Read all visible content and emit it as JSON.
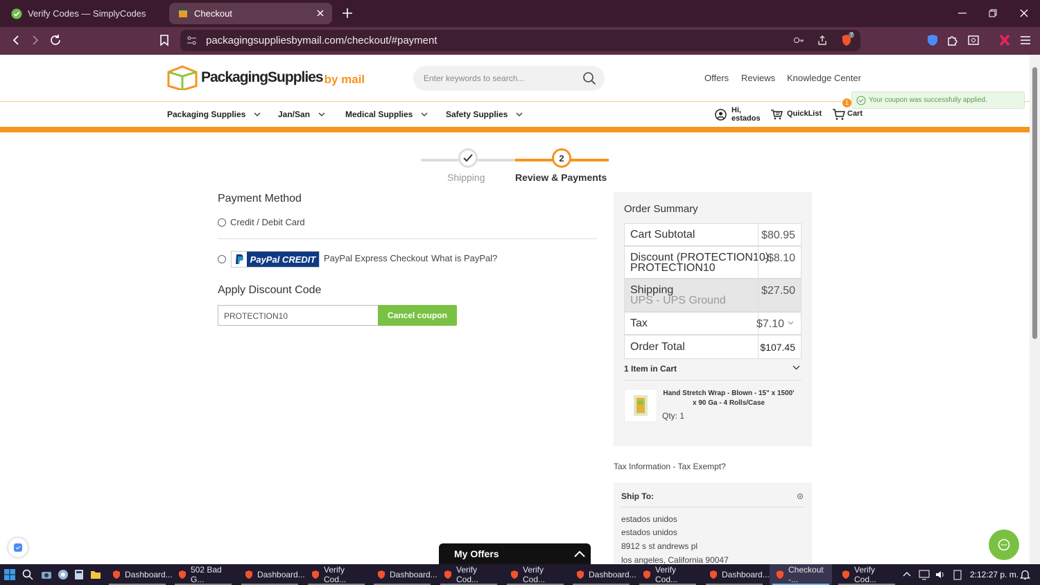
{
  "browser": {
    "tabs": [
      {
        "title": "Verify Codes — SimplyCodes",
        "active": false
      },
      {
        "title": "Checkout",
        "active": true
      }
    ],
    "url": "packagingsuppliesbymail.com/checkout/#payment",
    "extension_badge": "7"
  },
  "header": {
    "logo_main": "PackagingSupplies",
    "logo_sub": "by mail",
    "search_placeholder": "Enter keywords to search...",
    "links": [
      "Offers",
      "Reviews",
      "Knowledge Center"
    ],
    "toast": "Your coupon was successfully applied.",
    "nav": [
      "Packaging Supplies",
      "Jan/San",
      "Medical Supplies",
      "Safety Supplies"
    ],
    "account_hi": "Hi,",
    "account_name": "estados",
    "quicklist": "QuickList",
    "cart": "Cart",
    "cart_count": "1"
  },
  "stepper": {
    "step1_label": "Shipping",
    "step2_label": "Review & Payments",
    "step2_number": "2"
  },
  "payment": {
    "title": "Payment Method",
    "credit_label": "Credit / Debit Card",
    "paypal_button": "PayPal CREDIT",
    "paypal_express": "PayPal Express Checkout",
    "paypal_what": "What is PayPal?",
    "discount_title": "Apply Discount Code",
    "coupon_value": "PROTECTION10",
    "cancel_coupon": "Cancel coupon"
  },
  "summary": {
    "title": "Order Summary",
    "rows": [
      {
        "label": "Cart Subtotal",
        "value": "$80.95"
      },
      {
        "label": "Discount (PROTECTION10)",
        "label2": "PROTECTION10",
        "value": "-$8.10"
      },
      {
        "label": "Shipping",
        "label2": "UPS - UPS Ground",
        "value": "$27.50"
      },
      {
        "label": "Tax",
        "value": "$7.10"
      },
      {
        "label": "Order Total",
        "value": "$107.45"
      }
    ],
    "items_in_cart": "1 Item in Cart",
    "product_name": "Hand Stretch Wrap - Blown - 15\" x 1500' x 90 Ga - 4 Rolls/Case",
    "product_qty": "Qty: 1"
  },
  "tax_info": "Tax Information - Tax Exempt?",
  "ship_to": {
    "title": "Ship To:",
    "lines": [
      "estados unidos",
      "estados unidos",
      "8912 s st andrews pl",
      "los angeles, California 90047"
    ]
  },
  "my_offers": "My Offers",
  "taskbar": {
    "items": [
      "Dashboard...",
      "502 Bad G...",
      "Dashboard...",
      "Verify Cod...",
      "Dashboard...",
      "Verify Cod...",
      "Verify Cod...",
      "Dashboard...",
      "Verify Cod...",
      "Dashboard...",
      "Checkout -...",
      "Verify Cod..."
    ],
    "active_index": 10,
    "clock": "2:12:27 p. m."
  },
  "colors": {
    "accent": "#f7941d",
    "green": "#7ac143",
    "paypal": "#0e3a84"
  }
}
